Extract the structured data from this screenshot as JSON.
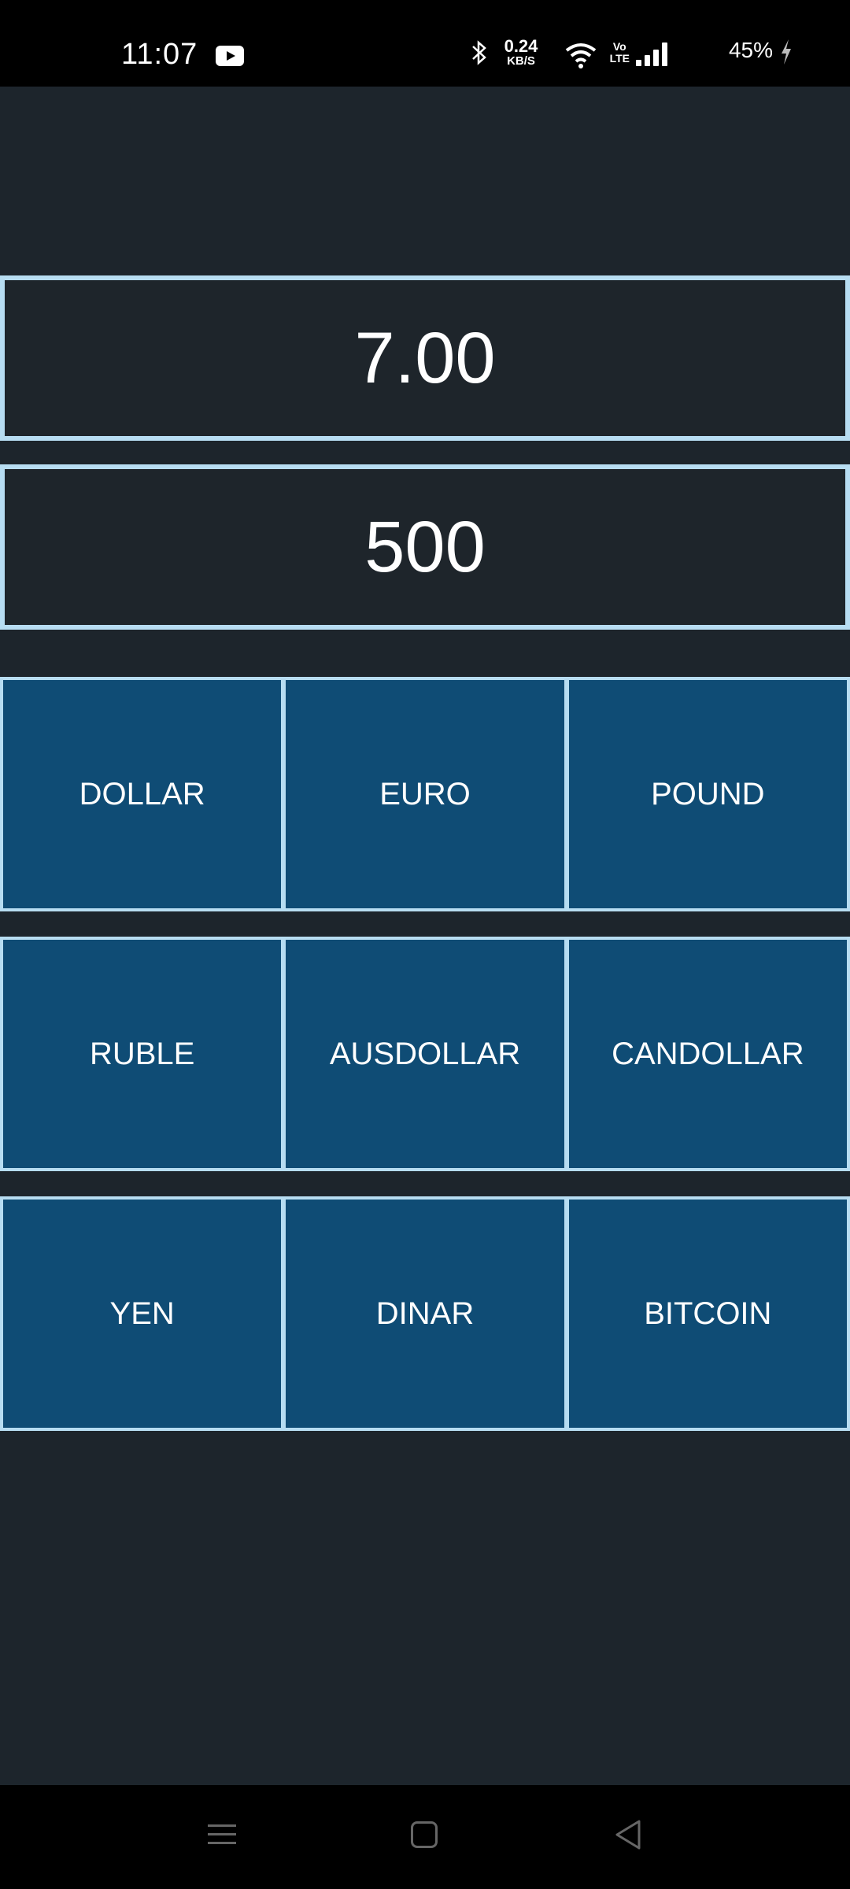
{
  "status_bar": {
    "time": "11:07",
    "net_speed_value": "0.24",
    "net_speed_unit": "KB/S",
    "volte_top": "Vo",
    "volte_bottom": "LTE",
    "battery": "45%",
    "icons": [
      "youtube-icon",
      "bluetooth-icon",
      "wifi-icon",
      "signal-icon",
      "charging-icon"
    ]
  },
  "converter": {
    "result": "7.00",
    "amount": "500"
  },
  "currencies": {
    "row1": [
      "DOLLAR",
      "EURO",
      "POUND"
    ],
    "row2": [
      "RUBLE",
      "AUSDOLLAR",
      "CANDOLLAR"
    ],
    "row3": [
      "YEN",
      "DINAR",
      "BITCOIN"
    ]
  },
  "colors": {
    "background": "#1d252c",
    "button": "#0f4c75",
    "border": "#b7ddf2"
  }
}
